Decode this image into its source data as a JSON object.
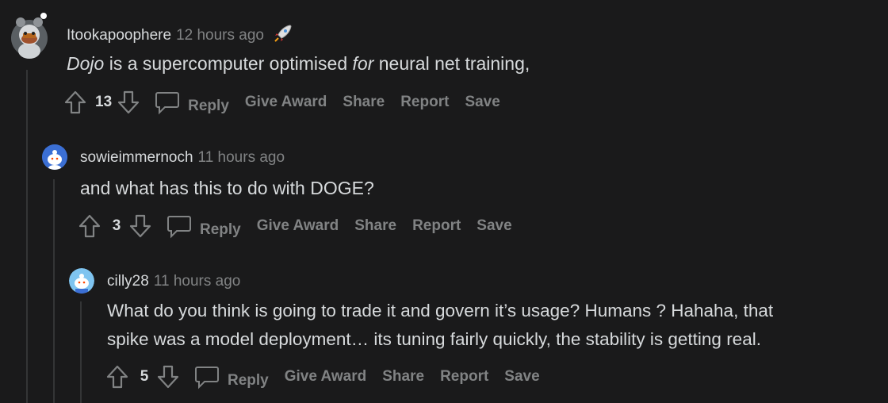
{
  "comments": [
    {
      "username": "Itookapoophere",
      "time": "12 hours ago",
      "award_icon": "rocket-icon",
      "body_em1": "Dojo",
      "body_mid": " is a supercomputer optimised ",
      "body_em2": "for",
      "body_end": " neural net training,",
      "score": "13",
      "reply_label": "Reply",
      "give_award_label": "Give Award",
      "share_label": "Share",
      "report_label": "Report",
      "save_label": "Save"
    },
    {
      "username": "sowieimmernoch",
      "time": "11 hours ago",
      "body": "and what has this to do with DOGE?",
      "score": "3",
      "reply_label": "Reply",
      "give_award_label": "Give Award",
      "share_label": "Share",
      "report_label": "Report",
      "save_label": "Save"
    },
    {
      "username": "cilly28",
      "time": "11 hours ago",
      "body_line1": "What do you think is going to trade it and govern it’s usage? Humans ? Hahaha, that",
      "body_line2": "spike was a model deployment… its tuning fairly quickly, the stability is getting real.",
      "score": "5",
      "reply_label": "Reply",
      "give_award_label": "Give Award",
      "share_label": "Share",
      "report_label": "Report",
      "save_label": "Save"
    }
  ],
  "colors": {
    "background": "#1a1a1b",
    "text": "#d7dadc",
    "muted": "#818384",
    "thread_line": "#343536",
    "avatar_blue": "#3b6fd4"
  }
}
